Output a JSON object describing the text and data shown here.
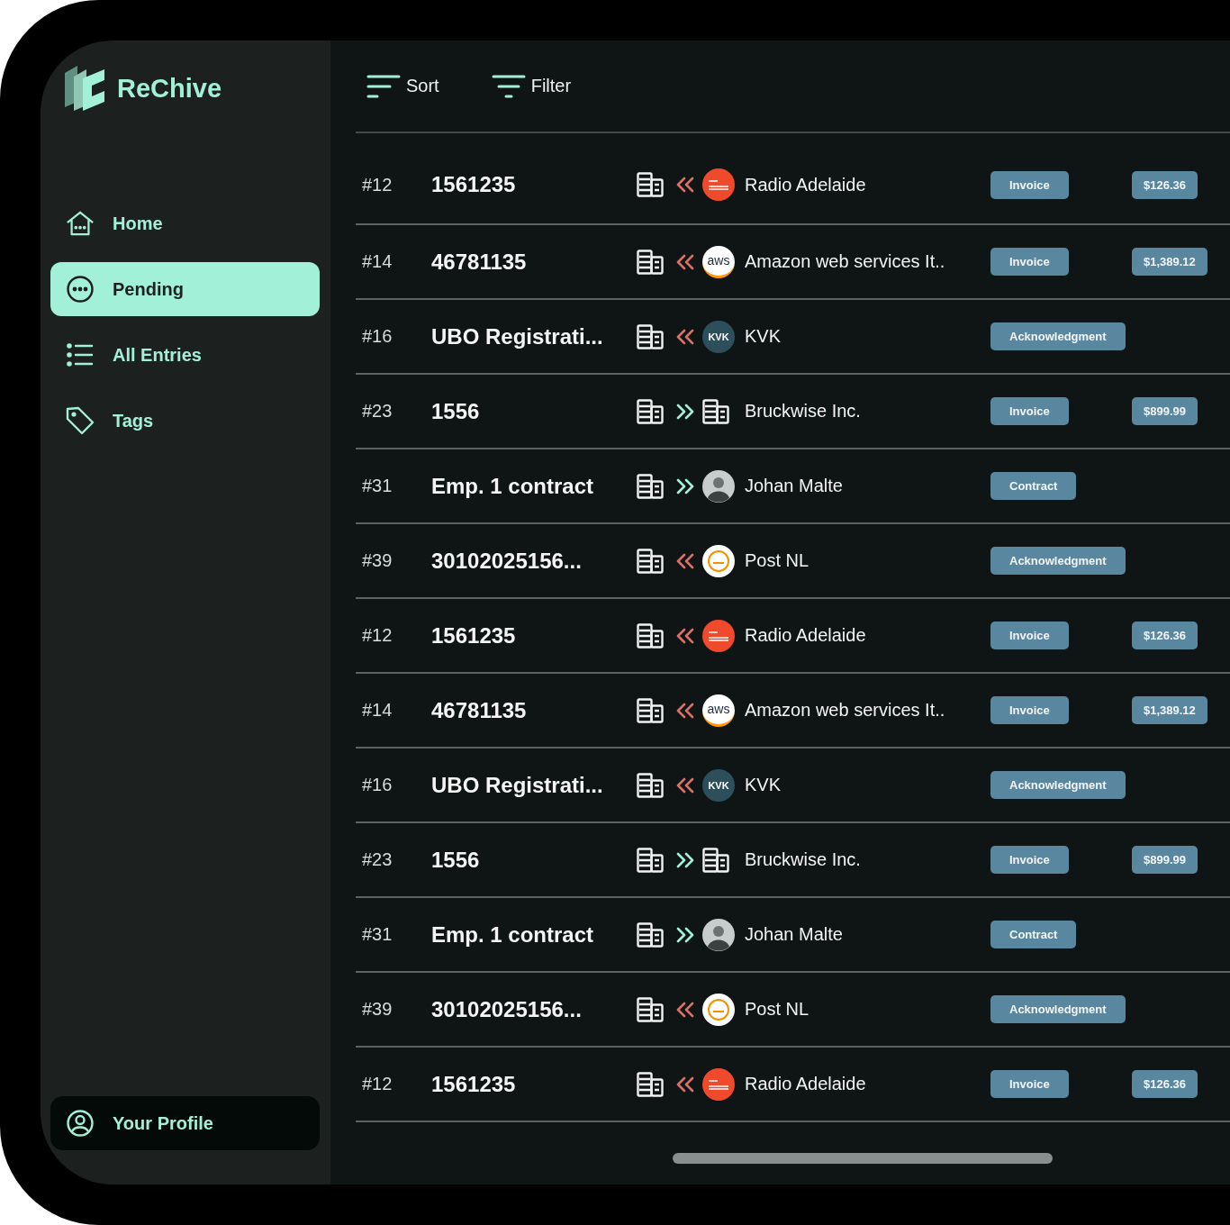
{
  "brand": {
    "name": "ReChive"
  },
  "sidebar": {
    "items": [
      {
        "label": "Home",
        "kind": "home",
        "selected": false
      },
      {
        "label": "Pending",
        "kind": "pending",
        "selected": true
      },
      {
        "label": "All Entries",
        "kind": "list",
        "selected": false
      },
      {
        "label": "Tags",
        "kind": "tag",
        "selected": false
      }
    ],
    "profile": {
      "label": "Your Profile"
    }
  },
  "toolbar": [
    {
      "label": "Sort",
      "kind": "sort"
    },
    {
      "label": "Filter",
      "kind": "filter"
    }
  ],
  "rows": [
    {
      "number": "#12",
      "title": "1561235",
      "kind": "incoming",
      "contact": {
        "kind": "radio",
        "name": "Radio Adelaide"
      },
      "doc_type": "Invoice",
      "amount": "$126.36"
    },
    {
      "number": "#14",
      "title": "46781135",
      "kind": "incoming",
      "contact": {
        "kind": "aws",
        "logo_text": "aws",
        "name": "Amazon web services It.."
      },
      "doc_type": "Invoice",
      "amount": "$1,389.12"
    },
    {
      "number": "#16",
      "title": "UBO Registrati...",
      "kind": "incoming",
      "contact": {
        "kind": "kvk",
        "logo_text": "KVK",
        "name": "KVK"
      },
      "doc_type": "Acknowledgment"
    },
    {
      "number": "#23",
      "title": "1556",
      "kind": "outgoing",
      "contact": {
        "kind": "building",
        "name": "Bruckwise Inc."
      },
      "doc_type": "Invoice",
      "amount": "$899.99"
    },
    {
      "number": "#31",
      "title": "Emp. 1 contract",
      "kind": "outgoing",
      "contact": {
        "kind": "person",
        "name": "Johan Malte"
      },
      "doc_type": "Contract"
    },
    {
      "number": "#39",
      "title": "30102025156...",
      "kind": "incoming",
      "contact": {
        "kind": "postnl",
        "name": "Post NL"
      },
      "doc_type": "Acknowledgment"
    },
    {
      "number": "#12",
      "title": "1561235",
      "kind": "incoming",
      "contact": {
        "kind": "radio",
        "name": "Radio Adelaide"
      },
      "doc_type": "Invoice",
      "amount": "$126.36"
    },
    {
      "number": "#14",
      "title": "46781135",
      "kind": "incoming",
      "contact": {
        "kind": "aws",
        "logo_text": "aws",
        "name": "Amazon web services It.."
      },
      "doc_type": "Invoice",
      "amount": "$1,389.12"
    },
    {
      "number": "#16",
      "title": "UBO Registrati...",
      "kind": "incoming",
      "contact": {
        "kind": "kvk",
        "logo_text": "KVK",
        "name": "KVK"
      },
      "doc_type": "Acknowledgment"
    },
    {
      "number": "#23",
      "title": "1556",
      "kind": "outgoing",
      "contact": {
        "kind": "building",
        "name": "Bruckwise Inc."
      },
      "doc_type": "Invoice",
      "amount": "$899.99"
    },
    {
      "number": "#31",
      "title": "Emp. 1 contract",
      "kind": "outgoing",
      "contact": {
        "kind": "person",
        "name": "Johan Malte"
      },
      "doc_type": "Contract"
    },
    {
      "number": "#39",
      "title": "30102025156...",
      "kind": "incoming",
      "contact": {
        "kind": "postnl",
        "name": "Post NL"
      },
      "doc_type": "Acknowledgment"
    },
    {
      "number": "#12",
      "title": "1561235",
      "kind": "incoming",
      "contact": {
        "kind": "radio",
        "name": "Radio Adelaide"
      },
      "doc_type": "Invoice",
      "amount": "$126.36"
    }
  ]
}
